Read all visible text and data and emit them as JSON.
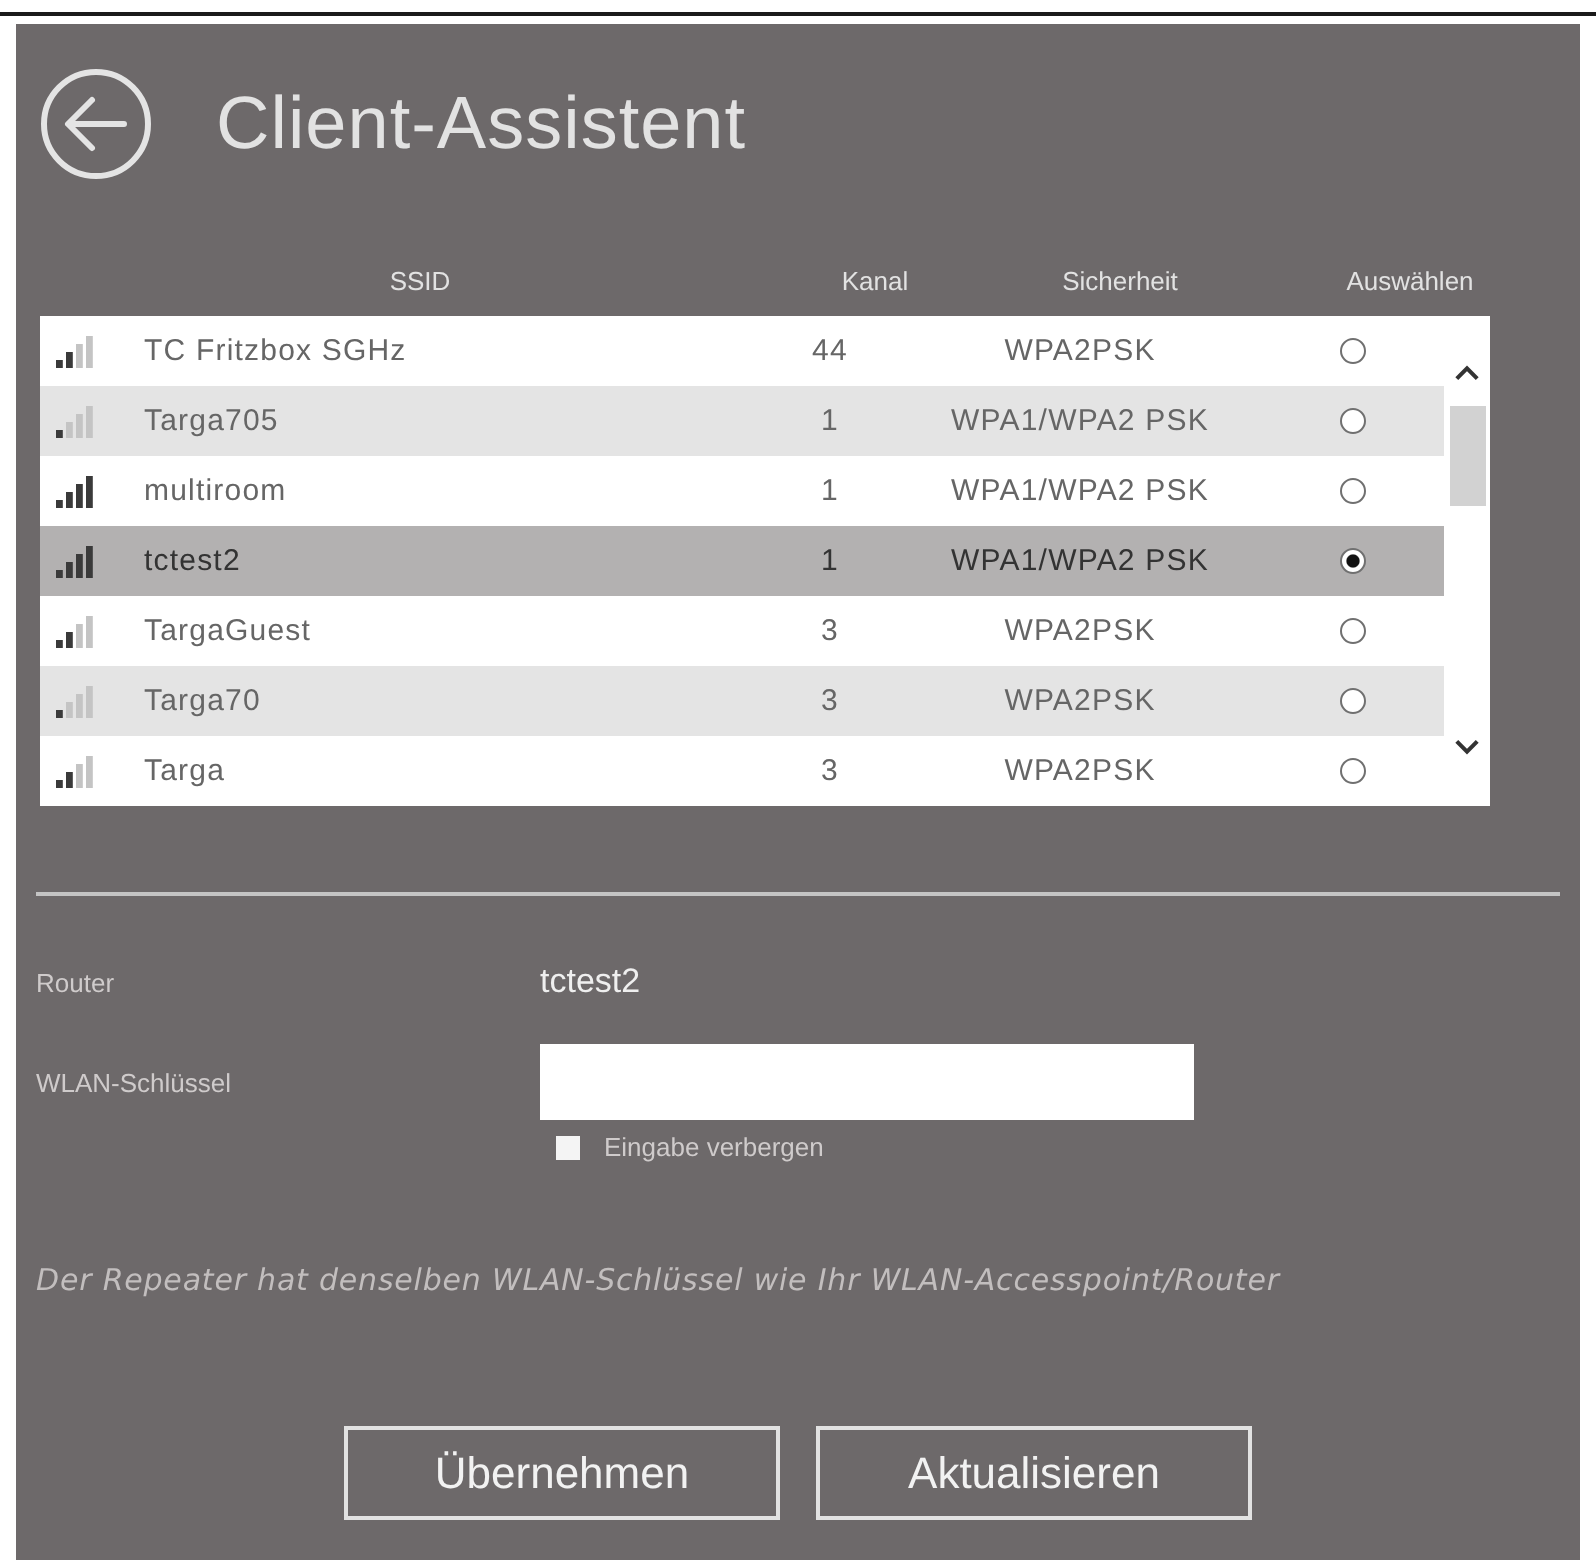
{
  "header": {
    "title": "Client-Assistent"
  },
  "table": {
    "columns": [
      "SSID",
      "Kanal",
      "Sicherheit",
      "Auswählen"
    ],
    "rows": [
      {
        "kind": "fair",
        "ssid": "TC Fritzbox SGHz",
        "channel": "44",
        "security": "WPA2PSK",
        "selected": false
      },
      {
        "kind": "weak",
        "ssid": "Targa705",
        "channel": "1",
        "security": "WPA1/WPA2 PSK",
        "selected": false
      },
      {
        "kind": "strong",
        "ssid": "multiroom",
        "channel": "1",
        "security": "WPA1/WPA2 PSK",
        "selected": false
      },
      {
        "kind": "strong",
        "ssid": "tctest2",
        "channel": "1",
        "security": "WPA1/WPA2 PSK",
        "selected": true
      },
      {
        "kind": "fair",
        "ssid": "TargaGuest",
        "channel": "3",
        "security": "WPA2PSK",
        "selected": false
      },
      {
        "kind": "weak",
        "ssid": "Targa70",
        "channel": "3",
        "security": "WPA2PSK",
        "selected": false
      },
      {
        "kind": "fair",
        "ssid": "Targa",
        "channel": "3",
        "security": "WPA2PSK",
        "selected": false
      }
    ]
  },
  "router": {
    "label": "Router",
    "value": "tctest2"
  },
  "key": {
    "label": "WLAN-Schlüssel",
    "hide_input": {
      "label": "Eingabe verbergen",
      "checked": false
    }
  },
  "note": "Der Repeater hat denselben WLAN-Schlüssel wie Ihr WLAN-Accesspoint/Router",
  "buttons": [
    "Übernehmen",
    "Aktualisieren"
  ]
}
